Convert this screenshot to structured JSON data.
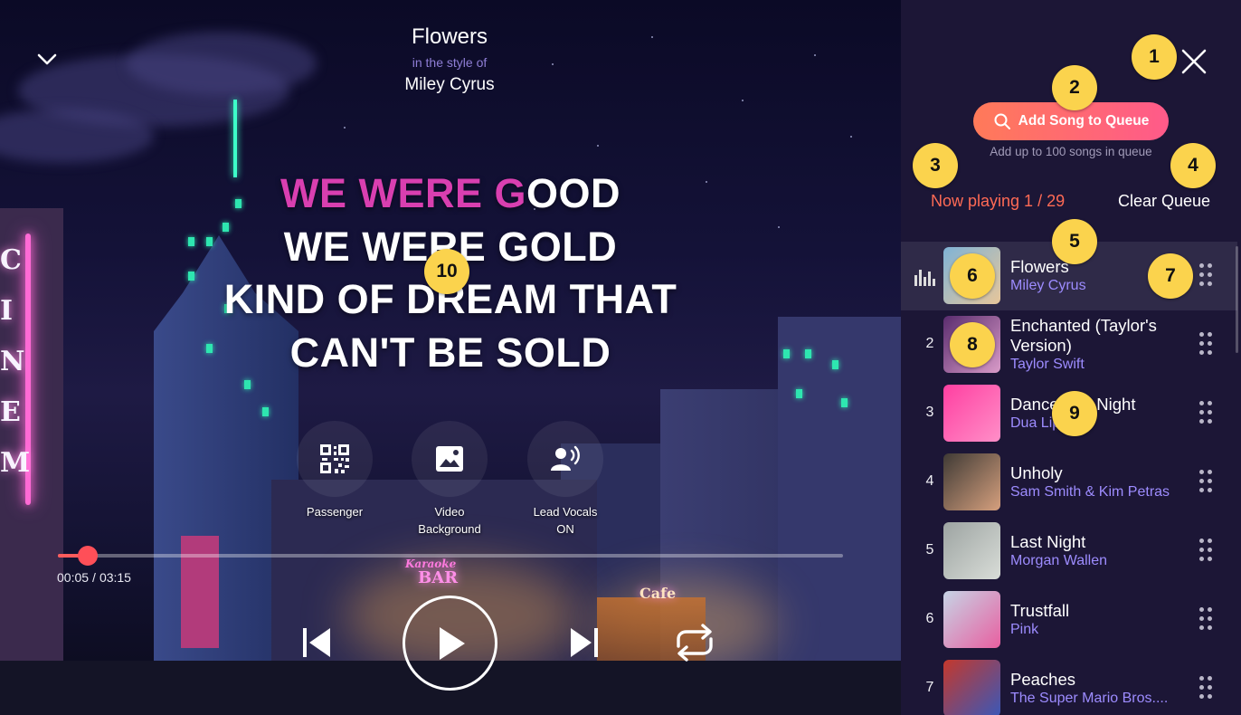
{
  "player": {
    "song_title": "Flowers",
    "style_label": "in the style of",
    "artist": "Miley Cyrus",
    "lyrics": {
      "line1_sung": "WE WERE G",
      "line1_rest": "OOD",
      "line2": "WE WERE GOLD",
      "line3": "KIND OF DREAM THAT",
      "line4": "CAN'T BE SOLD"
    },
    "controls": {
      "passenger_label": "Passenger",
      "video_label_1": "Video",
      "video_label_2": "Background",
      "vocals_label_1": "Lead Vocals",
      "vocals_label_2": "ON"
    },
    "progress": {
      "current": "00:05",
      "separator": "/",
      "total": "03:15",
      "fraction": 0.038
    },
    "scene_signs": {
      "karaoke": "Karaoke",
      "bar": "BAR",
      "cafe": "Cafe"
    }
  },
  "queue": {
    "add_button_label": "Add Song to Queue",
    "add_hint": "Add up to 100 songs in queue",
    "now_playing": "Now playing 1 / 29",
    "clear_label": "Clear Queue",
    "items": [
      {
        "num": "",
        "title": "Flowers",
        "artist": "Miley Cyrus",
        "art": [
          "#7fb3d6",
          "#e7c69a"
        ]
      },
      {
        "num": "2",
        "title": "Enchanted (Taylor's Version)",
        "artist": "Taylor Swift",
        "art": [
          "#5a2c6e",
          "#d99bc8"
        ]
      },
      {
        "num": "3",
        "title": "Dance The Night",
        "artist": "Dua Lipa",
        "art": [
          "#ff3fa1",
          "#ff8fc8"
        ]
      },
      {
        "num": "4",
        "title": "Unholy",
        "artist": "Sam Smith & Kim Petras",
        "art": [
          "#3f3a35",
          "#d6a07e"
        ]
      },
      {
        "num": "5",
        "title": "Last Night",
        "artist": "Morgan Wallen",
        "art": [
          "#9da4a2",
          "#d9ddd8"
        ]
      },
      {
        "num": "6",
        "title": "Trustfall",
        "artist": "Pink",
        "art": [
          "#c6d4e6",
          "#e85fa0"
        ]
      },
      {
        "num": "7",
        "title": "Peaches",
        "artist": "The Super Mario Bros....",
        "art": [
          "#c4382c",
          "#3a58b8"
        ]
      }
    ]
  },
  "badges": [
    "1",
    "2",
    "3",
    "4",
    "5",
    "6",
    "7",
    "8",
    "9",
    "10"
  ],
  "colors": {
    "accent": "#ff5a5a",
    "sung_lyric": "#d93fb0",
    "artist_purple": "#9d8cff",
    "badge": "#fbd34d"
  }
}
